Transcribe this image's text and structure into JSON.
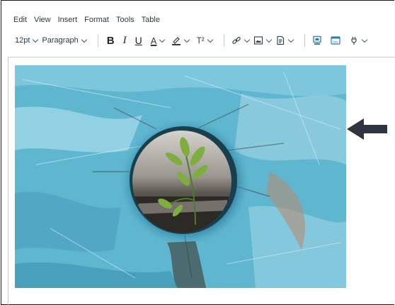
{
  "menu": {
    "edit": "Edit",
    "view": "View",
    "insert": "Insert",
    "format": "Format",
    "tools": "Tools",
    "table": "Table"
  },
  "toolbar": {
    "font_size": "12pt",
    "block_format": "Paragraph",
    "bold": "B",
    "italic": "I",
    "underline": "U",
    "text_color": "A",
    "superscript": "T²"
  },
  "icons": {
    "bold": "bold-icon",
    "italic": "italic-icon",
    "underline": "underline-icon",
    "text_color": "text-color-icon",
    "highlight": "highlight-pen-icon",
    "superscript": "superscript-icon",
    "link": "link-icon",
    "image": "image-icon",
    "document": "document-icon",
    "record": "record-media-icon",
    "box": "box-app-icon",
    "plugin": "plug-icon",
    "arrow": "left-arrow-icon"
  },
  "colors": {
    "accent": "#2d3b45",
    "highlight_underline": "#2d3b45",
    "app_icon": "#2b7abc",
    "arrow": "#2e3440"
  },
  "content": {
    "image_description": "Image of a blue painted board with a hole showing a small green plant growing"
  }
}
